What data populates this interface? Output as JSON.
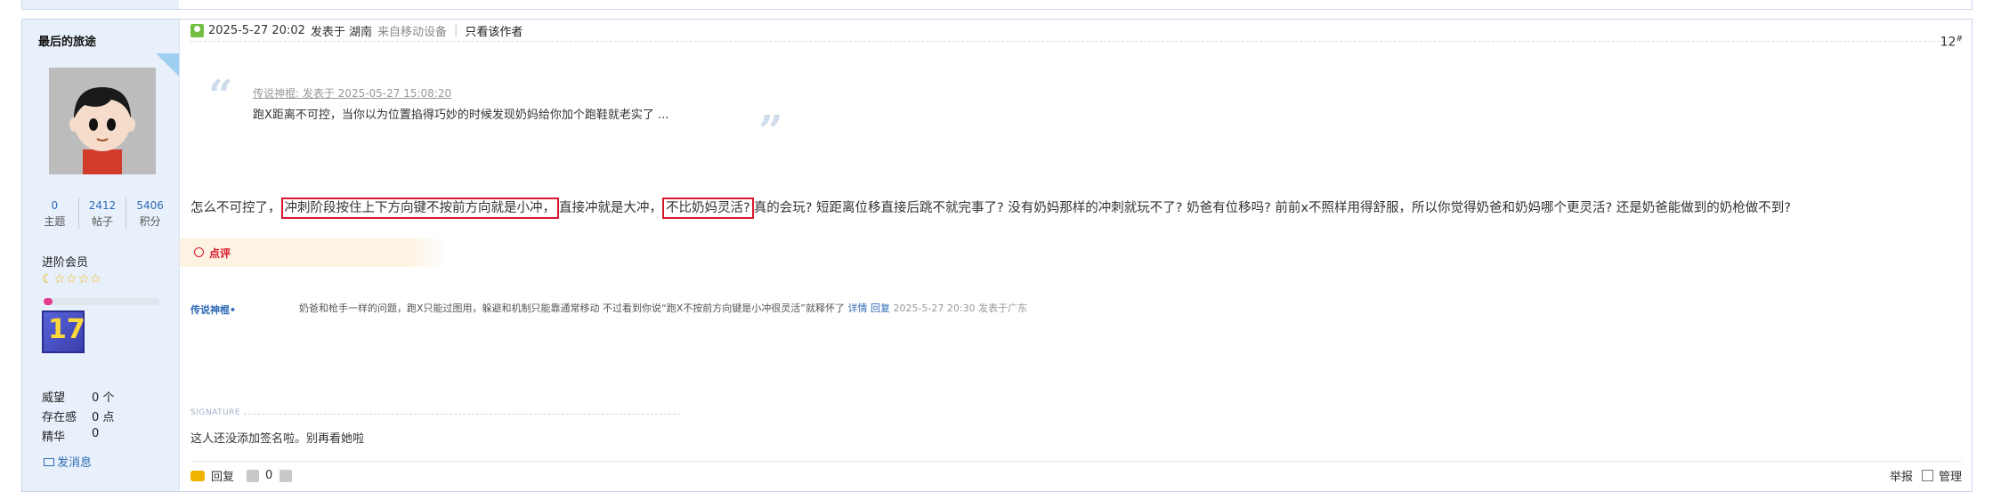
{
  "sidebar": {
    "username": "最后的旅途",
    "stats": [
      {
        "value": "0",
        "label": "主题"
      },
      {
        "value": "2412",
        "label": "帖子"
      },
      {
        "value": "5406",
        "label": "积分"
      }
    ],
    "rank": "进阶会员",
    "stars": "☾☆☆☆☆",
    "progress_fraction": 0.08,
    "badge_text": "17",
    "info": [
      {
        "label": "威望",
        "value": "0 个"
      },
      {
        "label": "存在感",
        "value": "0 点"
      },
      {
        "label": "精华",
        "value": "0"
      }
    ],
    "send_message": "发消息"
  },
  "post": {
    "time": "2025-5-27 20:02",
    "posted_in": "发表于 湖南",
    "via": "来自移动设备",
    "separator": "|",
    "author_only": "只看该作者",
    "floor": "12",
    "floor_sup": "#"
  },
  "quote": {
    "meta": "传说神棍: 发表于 2025-05-27 15:08:20",
    "text": "跑X距离不可控，当你以为位置掐得巧妙的时候发现奶妈给你加个跑鞋就老实了 ..."
  },
  "body": {
    "part1": "怎么不可控了，",
    "hl1": "冲刺阶段按住上下方向键不按前方向就是小冲，",
    "part2": "直接冲就是大冲，",
    "hl2": "不比奶妈灵活?",
    "part3": "真的会玩? 短距离位移直接后跳不就完事了? 没有奶妈那样的冲刺就玩不了? 奶爸有位移吗? 前前x不照样用得舒服，所以你觉得奶爸和奶妈哪个更灵活? 还是奶爸能做到的奶枪做不到?"
  },
  "rating": {
    "label": "点评"
  },
  "comment": {
    "user": "传说神棍",
    "text": "奶爸和枪手一样的问题，跑X只能过图用，躲避和机制只能靠通常移动 不过看到你说“跑X不按前方向键是小冲很灵活”就释怀了",
    "detail": "详情",
    "reply": "回复",
    "time": "2025-5-27 20:30 发表于广东"
  },
  "signature": {
    "label": "SIGNATURE",
    "text": "这人还没添加签名啦。别再看她啦"
  },
  "footer": {
    "reply": "回复",
    "likes": "0",
    "report": "举报",
    "manage": "管理"
  },
  "colors": {
    "link": "#2f6bb5",
    "highlight_border": "#d8192c",
    "sidebar_bg": "#e8f0fb"
  }
}
